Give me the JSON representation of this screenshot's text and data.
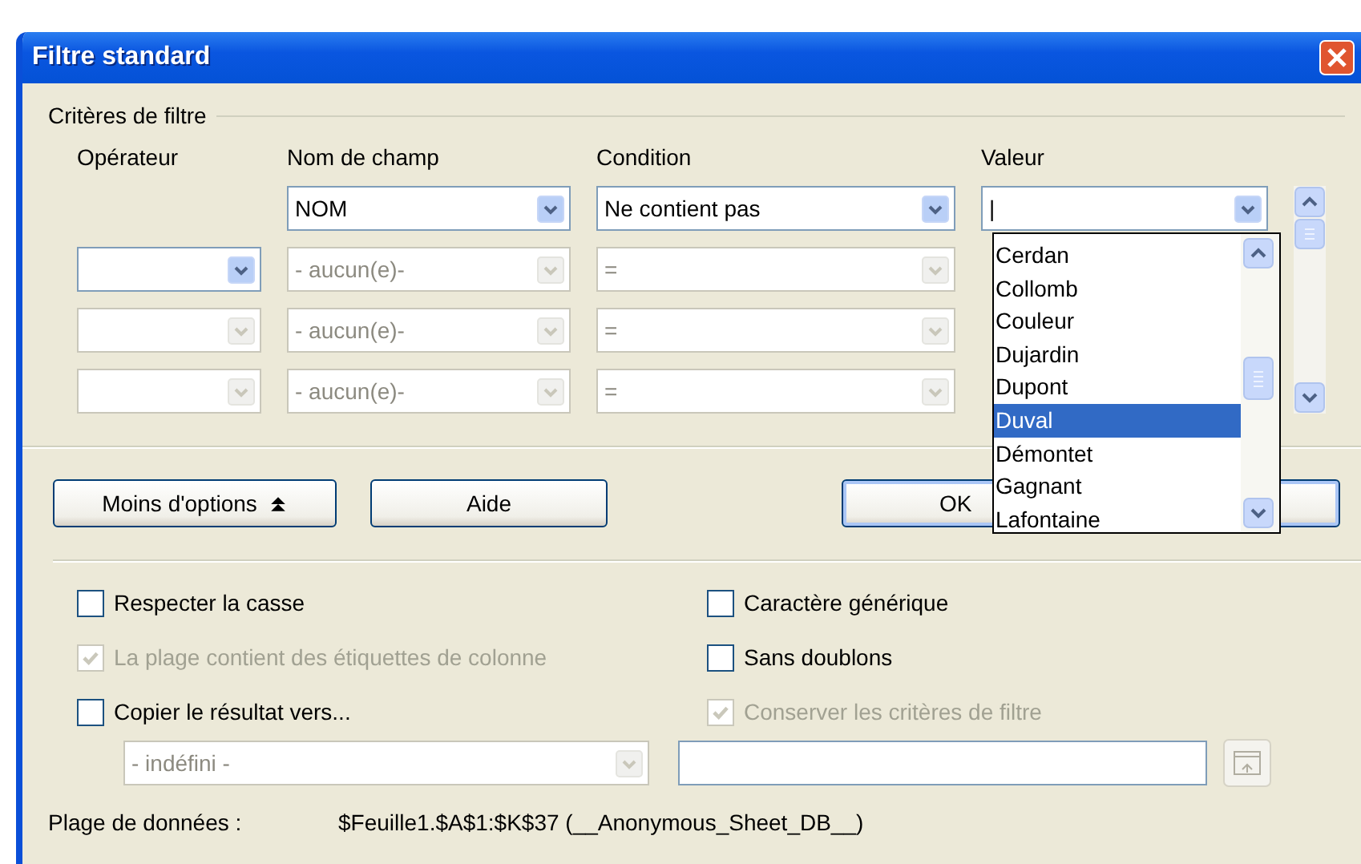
{
  "window": {
    "title": "Filtre standard"
  },
  "criteria": {
    "title": "Critères de filtre",
    "columns": [
      "Opérateur",
      "Nom de champ",
      "Condition",
      "Valeur"
    ],
    "rows": [
      {
        "field": {
          "text": "NOM",
          "disabled": false
        },
        "condition": {
          "text": "Ne contient pas",
          "disabled": false
        },
        "value": {
          "text": "|",
          "disabled": false
        }
      },
      {
        "operator": {
          "disabled": false
        },
        "field": {
          "text": "- aucun(e)-",
          "disabled": true
        },
        "condition": {
          "text": "=",
          "disabled": true
        }
      },
      {
        "operator": {
          "disabled": true
        },
        "field": {
          "text": "- aucun(e)-",
          "disabled": true
        },
        "condition": {
          "text": "=",
          "disabled": true
        }
      },
      {
        "operator": {
          "disabled": true
        },
        "field": {
          "text": "- aucun(e)-",
          "disabled": true
        },
        "condition": {
          "text": "=",
          "disabled": true
        }
      }
    ],
    "dropdown": [
      {
        "label": "Cerdan",
        "selected": false
      },
      {
        "label": "Collomb",
        "selected": false
      },
      {
        "label": "Couleur",
        "selected": false
      },
      {
        "label": "Dujardin",
        "selected": false
      },
      {
        "label": "Dupont",
        "selected": false
      },
      {
        "label": "Duval",
        "selected": true
      },
      {
        "label": "Démontet",
        "selected": false
      },
      {
        "label": "Gagnant",
        "selected": false
      },
      {
        "label": "Lafontaine",
        "selected": false
      }
    ]
  },
  "buttons": [
    {
      "label": "Moins d'options",
      "kind": "toggle"
    },
    {
      "label": "Aide",
      "kind": "plain"
    },
    {
      "label": "OK",
      "kind": "default"
    }
  ],
  "options": {
    "left": [
      {
        "label": "Respecter la casse",
        "checked": false,
        "disabled": false
      },
      {
        "label": "La plage contient des étiquettes de colonne",
        "checked": true,
        "disabled": true
      },
      {
        "label": "Copier le résultat vers...",
        "checked": false,
        "disabled": false
      }
    ],
    "right": [
      {
        "label": "Caractère générique",
        "checked": false,
        "disabled": false
      },
      {
        "label": "Sans doublons",
        "checked": false,
        "disabled": false
      },
      {
        "label": "Conserver les critères de filtre",
        "checked": true,
        "disabled": true
      }
    ]
  },
  "copy_target": {
    "select": {
      "text": "- indéfini -",
      "disabled": true
    }
  },
  "footer": {
    "label": "Plage de données :",
    "value": "$Feuille1.$A$1:$K$37 (__Anonymous_Sheet_DB__)"
  }
}
